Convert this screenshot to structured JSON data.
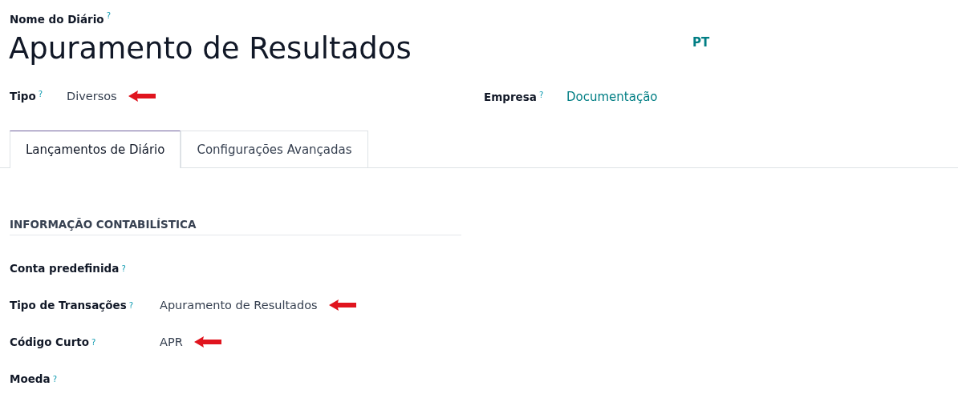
{
  "name_field": {
    "label": "Nome do Diário",
    "help": "?",
    "value": "Apuramento de Resultados"
  },
  "language": "PT",
  "type_field": {
    "label": "Tipo",
    "help": "?",
    "value": "Diversos",
    "annotated": true
  },
  "company_field": {
    "label": "Empresa",
    "help": "?",
    "value": "Documentação"
  },
  "tabs": [
    {
      "label": "Lançamentos de Diário",
      "selected": true
    },
    {
      "label": "Configurações Avançadas",
      "selected": false
    }
  ],
  "section": {
    "title": "INFORMAÇÃO CONTABILÍSTICA",
    "fields": [
      {
        "label": "Conta predefinida",
        "help": "?",
        "annotated": false
      },
      {
        "label": "Tipo de Transações",
        "help": "?",
        "value": "Apuramento de Resultados",
        "annotated": true
      },
      {
        "label": "Código Curto",
        "help": "?",
        "value": "APR",
        "annotated": true
      },
      {
        "label": "Moeda",
        "help": "?",
        "annotated": false
      }
    ]
  }
}
